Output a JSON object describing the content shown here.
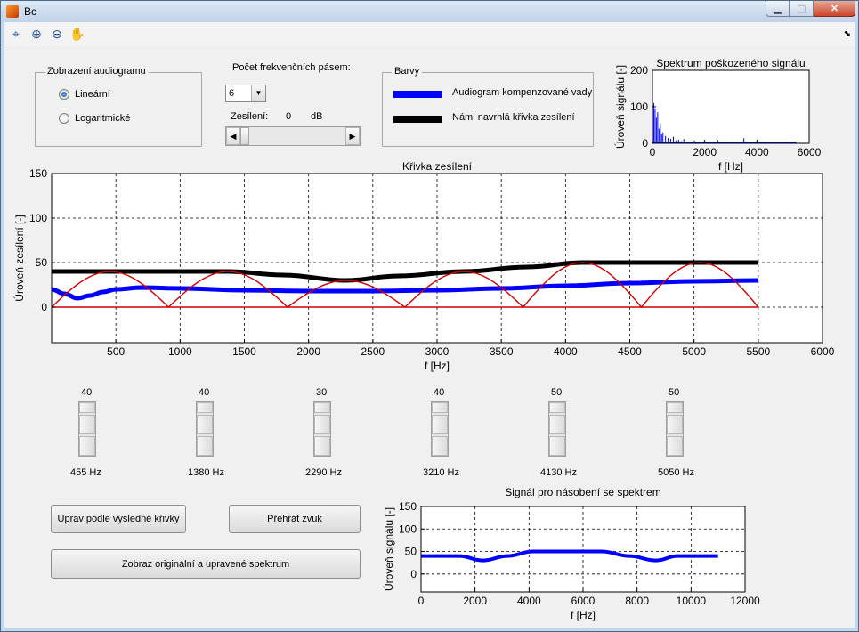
{
  "window": {
    "title": "Bc"
  },
  "toolbar": {
    "tools": [
      "data-cursor-icon",
      "zoom-in-icon",
      "zoom-out-icon",
      "pan-icon"
    ]
  },
  "audiogram_display": {
    "title": "Zobrazení audiogramu",
    "options": [
      "Lineární",
      "Logaritmické"
    ],
    "selected": "Lineární"
  },
  "bands": {
    "label": "Počet frekvenčních pásem:",
    "selected": "6",
    "gain_label": "Zesílení:",
    "gain_value": "0",
    "gain_unit": "dB"
  },
  "colors_panel": {
    "title": "Barvy",
    "items": [
      {
        "label": "Audiogram kompenzované vady",
        "color": "#0000ff"
      },
      {
        "label": "Námi navrhlá křivka zesílení",
        "color": "#000000"
      }
    ]
  },
  "sliders": [
    {
      "value": "40",
      "freq": "455 Hz"
    },
    {
      "value": "40",
      "freq": "1380 Hz"
    },
    {
      "value": "30",
      "freq": "2290 Hz"
    },
    {
      "value": "40",
      "freq": "3210 Hz"
    },
    {
      "value": "50",
      "freq": "4130 Hz"
    },
    {
      "value": "50",
      "freq": "5050 Hz"
    }
  ],
  "buttons": {
    "adjust": "Uprav podle výsledné křivky",
    "play": "Přehrát zvuk",
    "show_spectrum": "Zobraz originální a upravené spektrum"
  },
  "chart_data": [
    {
      "id": "spectrum",
      "type": "line",
      "title": "Spektrum poškozeného signálu",
      "xlabel": "f [Hz]",
      "ylabel": "Úroveň signálu [-]",
      "xlim": [
        0,
        6000
      ],
      "ylim": [
        0,
        200
      ],
      "xticks": [
        0,
        2000,
        4000,
        6000
      ],
      "yticks": [
        0,
        100,
        200
      ],
      "grid": false,
      "series": [
        {
          "color": "#0000ff",
          "x": [
            0,
            50,
            100,
            150,
            200,
            250,
            300,
            350,
            400,
            500,
            600,
            700,
            800,
            900,
            1000,
            1100,
            1200,
            1400,
            1600,
            1800,
            2000,
            2200,
            2500,
            2800,
            3000,
            3200,
            3500,
            3800,
            4000,
            4300,
            4600,
            5000,
            5300,
            5500
          ],
          "y": [
            5,
            110,
            95,
            70,
            85,
            40,
            55,
            25,
            30,
            20,
            15,
            12,
            18,
            8,
            10,
            6,
            12,
            5,
            8,
            4,
            6,
            3,
            9,
            4,
            5,
            3,
            14,
            3,
            4,
            3,
            2,
            2,
            3,
            2
          ]
        }
      ]
    },
    {
      "id": "gain-curve",
      "type": "line",
      "title": "Křivka zesílení",
      "xlabel": "f [Hz]",
      "ylabel": "Úroveň zesílení [-]",
      "xlim": [
        0,
        6000
      ],
      "ylim": [
        -40,
        150
      ],
      "xticks": [
        500,
        1000,
        1500,
        2000,
        2500,
        3000,
        3500,
        4000,
        4500,
        5000,
        5500,
        6000
      ],
      "yticks": [
        0,
        50,
        100,
        150
      ],
      "grid": true,
      "series": [
        {
          "color": "#000000",
          "x": [
            0,
            455,
            1380,
            1800,
            2290,
            2700,
            3210,
            3700,
            4130,
            4600,
            5050,
            5500
          ],
          "y": [
            40,
            40,
            40,
            36,
            30,
            35,
            40,
            45,
            50,
            50,
            50,
            50
          ]
        },
        {
          "color": "#0000ff",
          "x": [
            0,
            100,
            200,
            300,
            400,
            500,
            700,
            1000,
            1500,
            2000,
            2500,
            3000,
            3500,
            4000,
            4500,
            5000,
            5500
          ],
          "y": [
            20,
            15,
            10,
            13,
            17,
            20,
            22,
            21,
            19,
            18,
            18,
            19,
            21,
            24,
            27,
            29,
            30
          ]
        },
        {
          "color": "#d00000",
          "x": [
            0,
            455,
            910,
            1380,
            1835,
            2290,
            2750,
            3210,
            3670,
            4130,
            4590,
            5050,
            5500
          ],
          "y": [
            0,
            40,
            0,
            40,
            0,
            30,
            0,
            40,
            0,
            50,
            0,
            50,
            0
          ]
        },
        {
          "color": "#d00000",
          "x": [
            0,
            5500
          ],
          "y": [
            0,
            0
          ]
        }
      ]
    },
    {
      "id": "multiply-signal",
      "type": "line",
      "title": "Signál pro násobení se spektrem",
      "xlabel": "f [Hz]",
      "ylabel": "Úroveň signálu [-]",
      "xlim": [
        0,
        12000
      ],
      "ylim": [
        -40,
        150
      ],
      "xticks": [
        0,
        2000,
        4000,
        6000,
        8000,
        10000,
        12000
      ],
      "yticks": [
        0,
        50,
        100,
        150
      ],
      "grid": true,
      "series": [
        {
          "color": "#0000ff",
          "x": [
            0,
            1400,
            2290,
            3210,
            4130,
            5050,
            6700,
            7700,
            8700,
            9500,
            10100,
            11000
          ],
          "y": [
            40,
            40,
            30,
            40,
            50,
            50,
            50,
            40,
            30,
            40,
            40,
            40
          ]
        }
      ]
    }
  ]
}
